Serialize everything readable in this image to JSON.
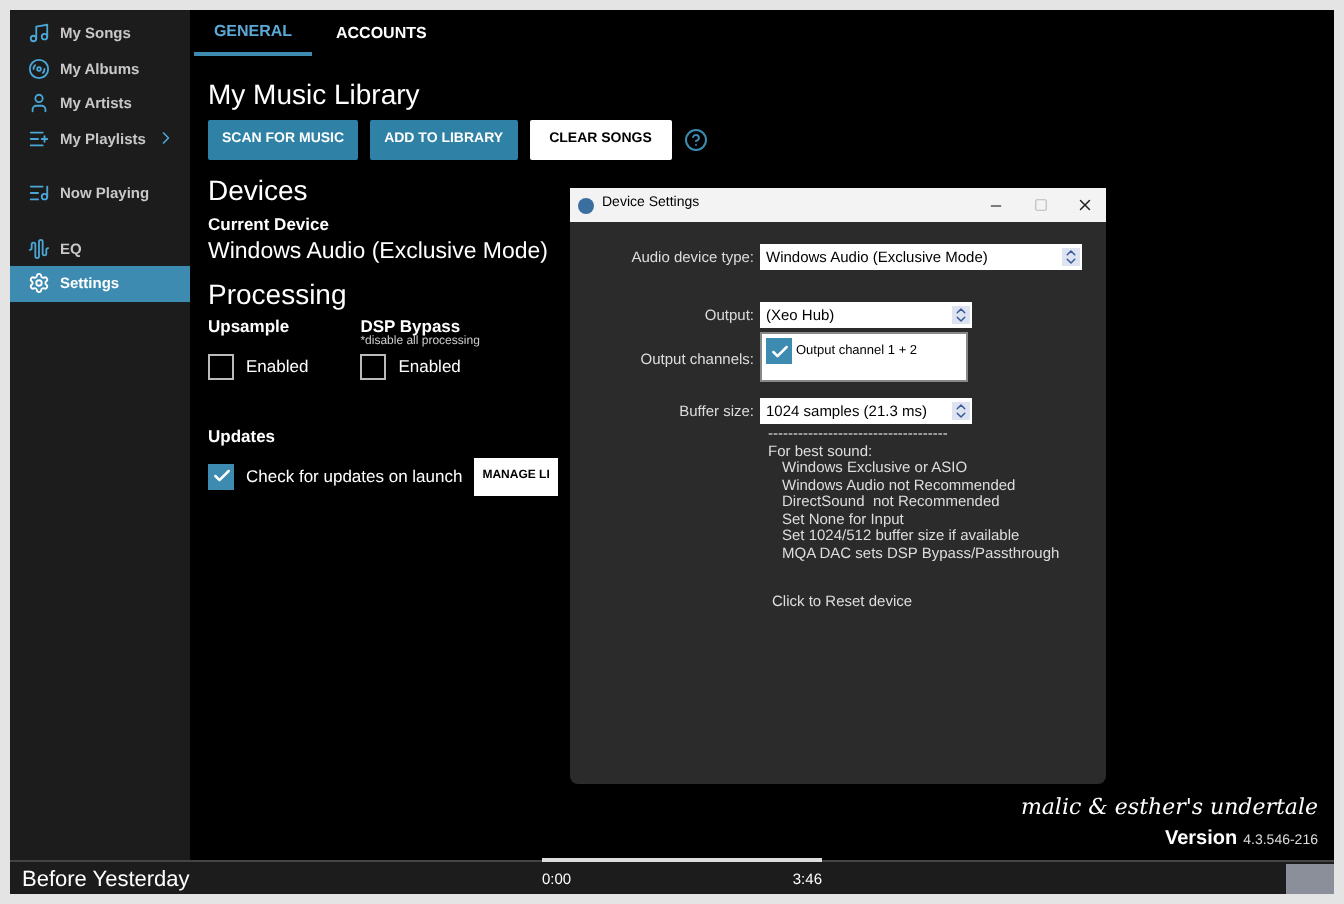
{
  "sidebar": {
    "groups": [
      {
        "items": [
          {
            "label": "My Songs",
            "selected": false,
            "submenu": false
          },
          {
            "label": "My Albums",
            "selected": false,
            "submenu": false
          },
          {
            "label": "My Artists",
            "selected": false,
            "submenu": false
          },
          {
            "label": "My Playlists",
            "selected": false,
            "submenu": true
          }
        ]
      },
      {
        "items": [
          {
            "label": "Now Playing",
            "selected": false,
            "submenu": false
          }
        ]
      },
      {
        "items": [
          {
            "label": "EQ",
            "selected": false,
            "submenu": false
          },
          {
            "label": "Settings",
            "selected": true,
            "submenu": false
          }
        ]
      }
    ]
  },
  "tabs": [
    {
      "label": "GENERAL",
      "selected": true
    },
    {
      "label": "ACCOUNTS",
      "selected": false
    }
  ],
  "library": {
    "title": "My Music Library",
    "buttons": [
      {
        "label": "SCAN FOR MUSIC",
        "kind": "primary"
      },
      {
        "label": "ADD TO LIBRARY",
        "kind": "primary"
      },
      {
        "label": "CLEAR SONGS",
        "kind": "secondary"
      }
    ]
  },
  "devices": {
    "heading": "Devices",
    "current_label": "Current Device",
    "current_value": "Windows Audio (Exclusive Mode)"
  },
  "processing": {
    "heading": "Processing",
    "options": [
      {
        "label": "Upsample",
        "check_label": "Enabled",
        "checked": false
      },
      {
        "label": "DSP Bypass",
        "note": "*disable all processing",
        "check_label": "Enabled",
        "checked": false
      }
    ]
  },
  "updates": {
    "heading": "Updates",
    "check": {
      "label": "Check for updates on launch",
      "checked": true
    },
    "button": "MANAGE LI"
  },
  "dialog": {
    "title": "Device Settings",
    "fields": [
      {
        "label": "Audio device type:",
        "kind": "select",
        "value": "Windows Audio (Exclusive Mode)"
      },
      {
        "label": "Output:",
        "kind": "select",
        "value": "(Xeo Hub)"
      },
      {
        "label": "Output channels:",
        "kind": "list",
        "items": [
          {
            "label": "Output channel 1 + 2",
            "checked": true
          }
        ]
      },
      {
        "label": "Buffer size:",
        "kind": "select",
        "value": "1024 samples (21.3 ms)"
      }
    ],
    "separator": "------------------------------------",
    "notes_heading": "For best sound:",
    "notes": [
      "Windows Exclusive or ASIO",
      "Windows Audio not Recommended",
      "DirectSound  not Recommended",
      "Set None for Input",
      "Set 1024/512 buffer size if available",
      "MQA DAC sets DSP Bypass/Passthrough"
    ],
    "reset": "Click to Reset device"
  },
  "credits": {
    "tagline": "malic & esther's undertale",
    "version_label": "Version",
    "version": "4.3.546-216"
  },
  "player": {
    "title": "Before Yesterday",
    "elapsed": "0:00",
    "duration": "3:46"
  }
}
